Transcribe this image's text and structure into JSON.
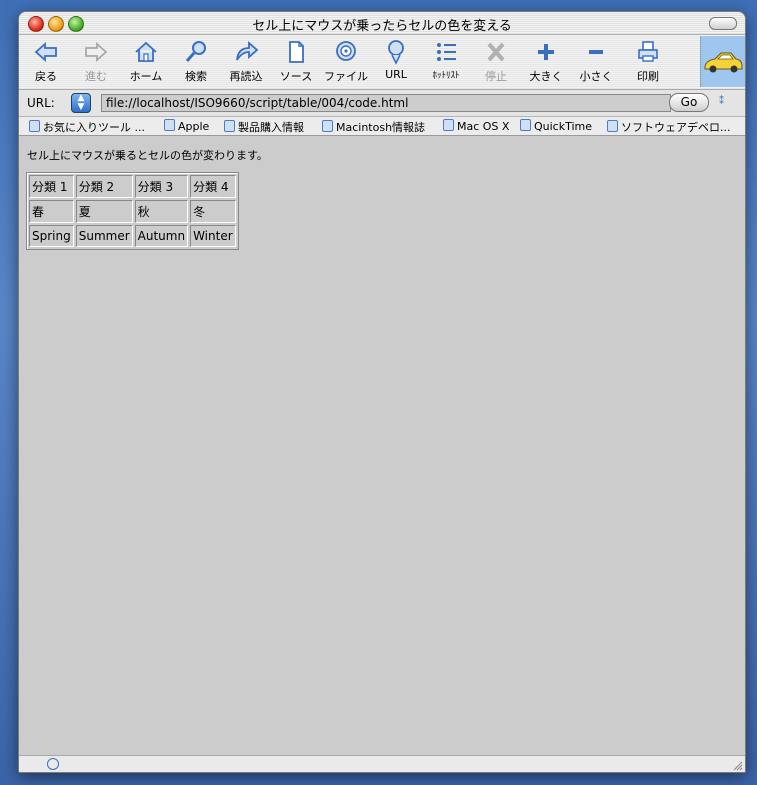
{
  "window": {
    "title": "セル上にマウスが乗ったらセルの色を変える"
  },
  "toolbar": {
    "buttons": [
      {
        "label": "戻る",
        "icon": "back-arrow-icon",
        "enabled": true
      },
      {
        "label": "進む",
        "icon": "forward-arrow-icon",
        "enabled": false
      },
      {
        "label": "ホーム",
        "icon": "home-icon",
        "enabled": true
      },
      {
        "label": "検索",
        "icon": "search-icon",
        "enabled": true
      },
      {
        "label": "再読込",
        "icon": "reload-icon",
        "enabled": true
      },
      {
        "label": "ソース",
        "icon": "source-icon",
        "enabled": true
      },
      {
        "label": "ファイル",
        "icon": "file-icon",
        "enabled": true
      },
      {
        "label": "URL",
        "icon": "url-icon",
        "enabled": true
      },
      {
        "label": "ﾎｯﾄﾘｽﾄ",
        "icon": "hotlist-icon",
        "enabled": true
      },
      {
        "label": "停止",
        "icon": "stop-icon",
        "enabled": false
      },
      {
        "label": "大きく",
        "icon": "plus-icon",
        "enabled": true
      },
      {
        "label": "小さく",
        "icon": "minus-icon",
        "enabled": true
      },
      {
        "label": "印刷",
        "icon": "print-icon",
        "enabled": true
      }
    ],
    "logo_icon": "car-logo-icon"
  },
  "address": {
    "label": "URL:",
    "value": "file://localhost/ISO9660/script/table/004/code.html",
    "go_label": "Go"
  },
  "favorites": [
    "お気に入りツール ...",
    "Apple",
    "製品購入情報",
    "Macintosh情報誌",
    "Mac OS X",
    "QuickTime",
    "ソフトウェアデベロ..."
  ],
  "content": {
    "intro": "セル上にマウスが乗るとセルの色が変わります。",
    "table": [
      [
        "分類 1",
        "分類 2",
        "分類 3",
        "分類 4"
      ],
      [
        "春",
        "夏",
        "秋",
        "冬"
      ],
      [
        "Spring",
        "Summer",
        "Autumn",
        "Winter"
      ]
    ]
  },
  "colors": {
    "content_bg": "#cccccc",
    "accent": "#2d6fd0",
    "hover": "#ffff99"
  }
}
